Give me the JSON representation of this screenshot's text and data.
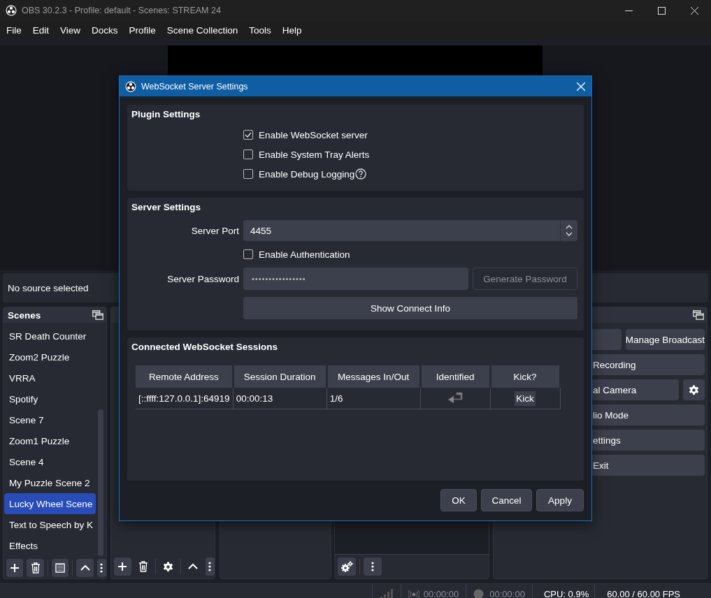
{
  "window": {
    "title": "OBS 30.2.3 - Profile: default - Scenes: STREAM 24"
  },
  "menu": [
    "File",
    "Edit",
    "View",
    "Docks",
    "Profile",
    "Scene Collection",
    "Tools",
    "Help"
  ],
  "source_bar": {
    "text": "No source selected"
  },
  "scenes_dock": {
    "title": "Scenes",
    "items": [
      {
        "label": "SR Death Counter",
        "selected": false
      },
      {
        "label": "Zoom2 Puzzle",
        "selected": false
      },
      {
        "label": "VRRA",
        "selected": false
      },
      {
        "label": "Spotify",
        "selected": false
      },
      {
        "label": "Scene 7",
        "selected": false
      },
      {
        "label": "Zoom1 Puzzle",
        "selected": false
      },
      {
        "label": "Scene 4",
        "selected": false
      },
      {
        "label": "My Puzzle Scene 2",
        "selected": false
      },
      {
        "label": "Lucky Wheel Scene",
        "selected": true
      },
      {
        "label": "Text to Speech by K",
        "selected": false
      },
      {
        "label": "Effects",
        "selected": false
      }
    ]
  },
  "controls_dock": {
    "buttons": [
      {
        "label": "Recording"
      },
      {
        "label": "al Camera"
      },
      {
        "label": "lio Mode"
      },
      {
        "label": "ettings"
      },
      {
        "label": "Exit"
      }
    ],
    "broadcast_button": "Manage Broadcast"
  },
  "status_bar": {
    "stream_time": "00:00:00",
    "record_time": "00:00:00",
    "cpu": "CPU: 0.9%",
    "fps": "60.00 / 60.00 FPS"
  },
  "dialog": {
    "title": "WebSocket Server Settings",
    "plugin_settings": {
      "title": "Plugin Settings",
      "options": [
        {
          "label": "Enable WebSocket server",
          "checked": true
        },
        {
          "label": "Enable System Tray Alerts",
          "checked": false
        },
        {
          "label": "Enable Debug Logging",
          "checked": false,
          "help": true
        }
      ]
    },
    "server_settings": {
      "title": "Server Settings",
      "port_label": "Server Port",
      "port": "4455",
      "auth": {
        "label": "Enable Authentication",
        "checked": false
      },
      "password_label": "Server Password",
      "password": "••••••••••••••••",
      "generate_button": "Generate Password",
      "connect_button": "Show Connect Info"
    },
    "sessions": {
      "title": "Connected WebSocket Sessions",
      "columns": [
        "Remote Address",
        "Session Duration",
        "Messages In/Out",
        "Identified",
        "Kick?"
      ],
      "rows": [
        {
          "cells": [
            "[::ffff:127.0.0.1]:64919",
            "00:00:13",
            "1/6"
          ],
          "identified": true,
          "kick": "Kick"
        }
      ]
    },
    "buttons": [
      "OK",
      "Cancel",
      "Apply"
    ]
  }
}
